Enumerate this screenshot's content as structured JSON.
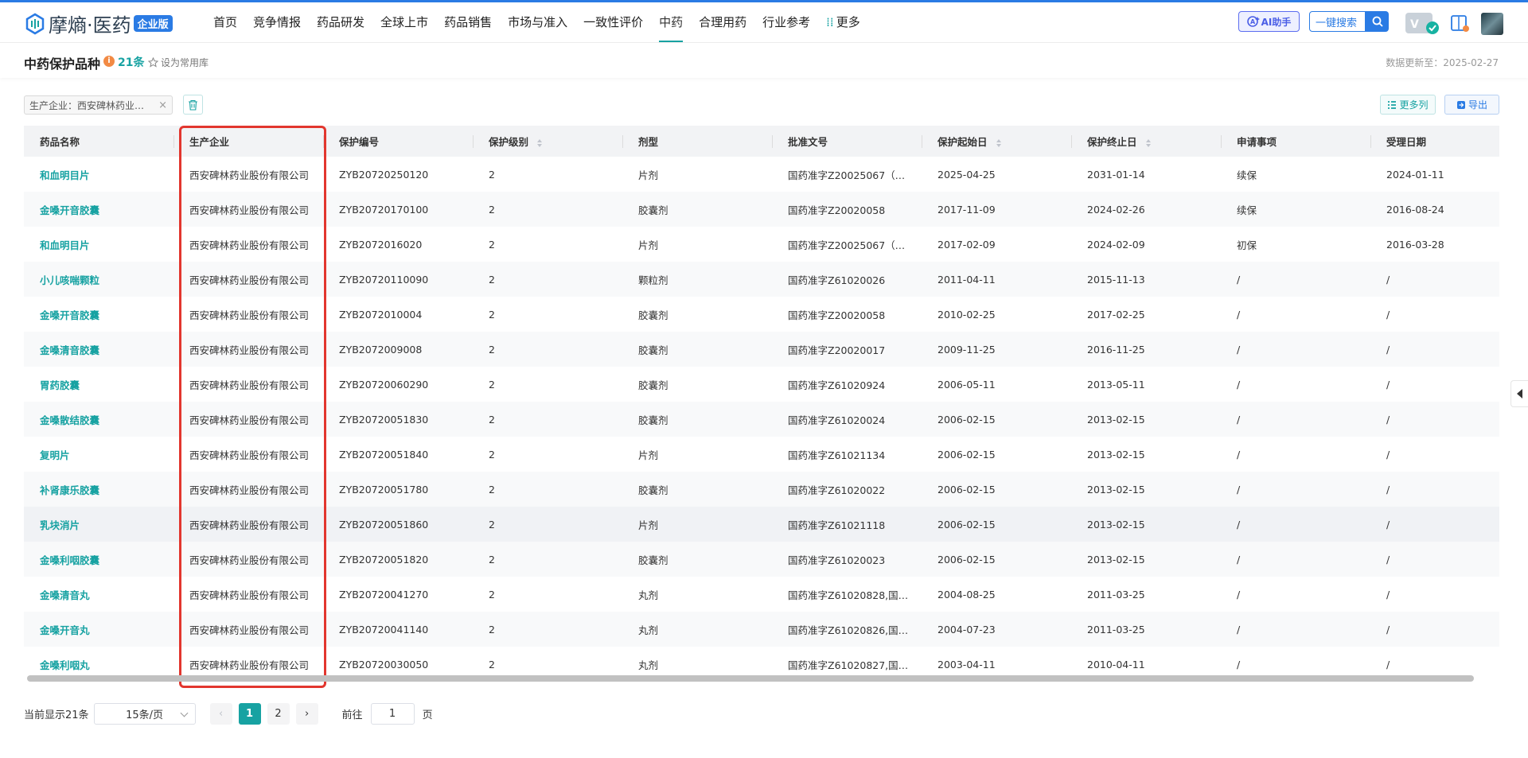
{
  "brand": {
    "name": "摩熵·医药",
    "badge": "企业版"
  },
  "nav": [
    "首页",
    "竞争情报",
    "药品研发",
    "全球上市",
    "药品销售",
    "市场与准入",
    "一致性评价",
    "中药",
    "合理用药",
    "行业参考",
    "更多"
  ],
  "nav_active": "中药",
  "header": {
    "ai_label": "AI助手",
    "search_label": "一键搜索"
  },
  "page": {
    "title": "中药保护品种",
    "count": "21条",
    "fav_label": "设为常用库",
    "updated": "数据更新至：2025-02-27"
  },
  "filter": {
    "tag": "生产企业：西安碑林药业…"
  },
  "toolbar": {
    "more_cols": "更多列",
    "export": "导出"
  },
  "table": {
    "columns": [
      "药品名称",
      "生产企业",
      "保护编号",
      "保护级别",
      "剂型",
      "批准文号",
      "保护起始日",
      "保护终止日",
      "申请事项",
      "受理日期"
    ],
    "sortable": [
      false,
      false,
      false,
      true,
      false,
      false,
      true,
      true,
      false,
      false
    ],
    "rows": [
      [
        "和血明目片",
        "西安碑林药业股份有限公司",
        "ZYB20720250120",
        "2",
        "片剂",
        "国药准字Z20025067（…",
        "2025-04-25",
        "2031-01-14",
        "续保",
        "2024-01-11"
      ],
      [
        "金嗓开音胶囊",
        "西安碑林药业股份有限公司",
        "ZYB20720170100",
        "2",
        "胶囊剂",
        "国药准字Z20020058",
        "2017-11-09",
        "2024-02-26",
        "续保",
        "2016-08-24"
      ],
      [
        "和血明目片",
        "西安碑林药业股份有限公司",
        "ZYB2072016020",
        "2",
        "片剂",
        "国药准字Z20025067（…",
        "2017-02-09",
        "2024-02-09",
        "初保",
        "2016-03-28"
      ],
      [
        "小儿咳喘颗粒",
        "西安碑林药业股份有限公司",
        "ZYB20720110090",
        "2",
        "颗粒剂",
        "国药准字Z61020026",
        "2011-04-11",
        "2015-11-13",
        "/",
        "/"
      ],
      [
        "金嗓开音胶囊",
        "西安碑林药业股份有限公司",
        "ZYB2072010004",
        "2",
        "胶囊剂",
        "国药准字Z20020058",
        "2010-02-25",
        "2017-02-25",
        "/",
        "/"
      ],
      [
        "金嗓清音胶囊",
        "西安碑林药业股份有限公司",
        "ZYB2072009008",
        "2",
        "胶囊剂",
        "国药准字Z20020017",
        "2009-11-25",
        "2016-11-25",
        "/",
        "/"
      ],
      [
        "胃药胶囊",
        "西安碑林药业股份有限公司",
        "ZYB20720060290",
        "2",
        "胶囊剂",
        "国药准字Z61020924",
        "2006-05-11",
        "2013-05-11",
        "/",
        "/"
      ],
      [
        "金嗓散结胶囊",
        "西安碑林药业股份有限公司",
        "ZYB20720051830",
        "2",
        "胶囊剂",
        "国药准字Z61020024",
        "2006-02-15",
        "2013-02-15",
        "/",
        "/"
      ],
      [
        "复明片",
        "西安碑林药业股份有限公司",
        "ZYB20720051840",
        "2",
        "片剂",
        "国药准字Z61021134",
        "2006-02-15",
        "2013-02-15",
        "/",
        "/"
      ],
      [
        "补肾康乐胶囊",
        "西安碑林药业股份有限公司",
        "ZYB20720051780",
        "2",
        "胶囊剂",
        "国药准字Z61020022",
        "2006-02-15",
        "2013-02-15",
        "/",
        "/"
      ],
      [
        "乳块消片",
        "西安碑林药业股份有限公司",
        "ZYB20720051860",
        "2",
        "片剂",
        "国药准字Z61021118",
        "2006-02-15",
        "2013-02-15",
        "/",
        "/"
      ],
      [
        "金嗓利咽胶囊",
        "西安碑林药业股份有限公司",
        "ZYB20720051820",
        "2",
        "胶囊剂",
        "国药准字Z61020023",
        "2006-02-15",
        "2013-02-15",
        "/",
        "/"
      ],
      [
        "金嗓清音丸",
        "西安碑林药业股份有限公司",
        "ZYB20720041270",
        "2",
        "丸剂",
        "国药准字Z61020828,国…",
        "2004-08-25",
        "2011-03-25",
        "/",
        "/"
      ],
      [
        "金嗓开音丸",
        "西安碑林药业股份有限公司",
        "ZYB20720041140",
        "2",
        "丸剂",
        "国药准字Z61020826,国…",
        "2004-07-23",
        "2011-03-25",
        "/",
        "/"
      ],
      [
        "金嗓利咽丸",
        "西安碑林药业股份有限公司",
        "ZYB20720030050",
        "2",
        "丸剂",
        "国药准字Z61020827,国…",
        "2003-04-11",
        "2010-04-11",
        "/",
        "/"
      ]
    ]
  },
  "pager": {
    "total": "当前显示21条",
    "page_size": "15条/页",
    "pages": [
      "1",
      "2"
    ],
    "current": "1",
    "goto_prefix": "前往",
    "goto_value": "1",
    "goto_suffix": "页",
    "prev": "‹",
    "next": "›"
  },
  "colors": {
    "accent": "#17a2a2",
    "brand": "#2a7be4",
    "highlight": "#e2362e"
  }
}
